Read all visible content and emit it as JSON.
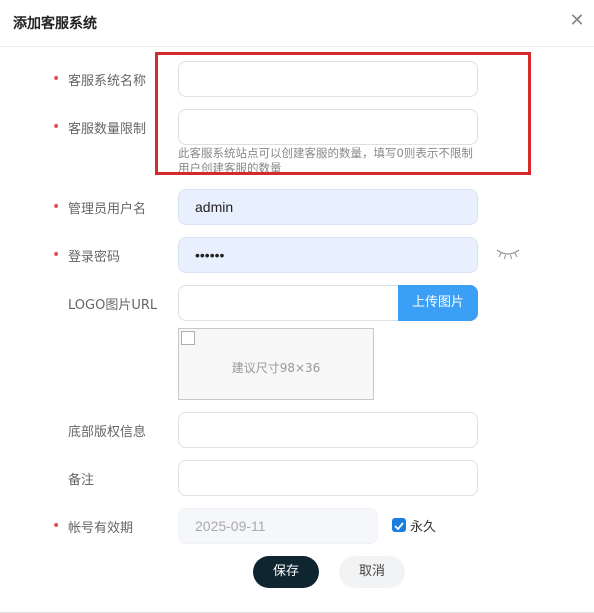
{
  "dialog": {
    "title": "添加客服系统",
    "close_icon": "close-icon"
  },
  "form": {
    "system_name": {
      "label": "客服系统名称",
      "required": true,
      "value": ""
    },
    "agent_limit": {
      "label": "客服数量限制",
      "required": true,
      "value": "",
      "hint": "此客服系统站点可以创建客服的数量，填写0则表示不限制用户创建客服的数量"
    },
    "admin_username": {
      "label": "管理员用户名",
      "required": true,
      "value": "admin"
    },
    "login_password": {
      "label": "登录密码",
      "required": true,
      "value": "••••••",
      "toggle_icon": "eye-closed-icon"
    },
    "logo_url": {
      "label": "LOGO图片URL",
      "required": false,
      "value": "",
      "upload_label": "上传图片",
      "preview_text": "建议尺寸98×36"
    },
    "copyright": {
      "label": "底部版权信息",
      "required": false,
      "value": ""
    },
    "remark": {
      "label": "备注",
      "required": false,
      "value": ""
    },
    "expiry": {
      "label": "帐号有效期",
      "required": true,
      "value": "2025-09-11",
      "permanent_label": "永久",
      "permanent_checked": true
    }
  },
  "actions": {
    "save_label": "保存",
    "cancel_label": "取消"
  },
  "colors": {
    "required_mark": "#e05050",
    "accent": "#3a9ff5",
    "highlight_box": "#d42a2a",
    "save_bg": "#0f2530"
  }
}
